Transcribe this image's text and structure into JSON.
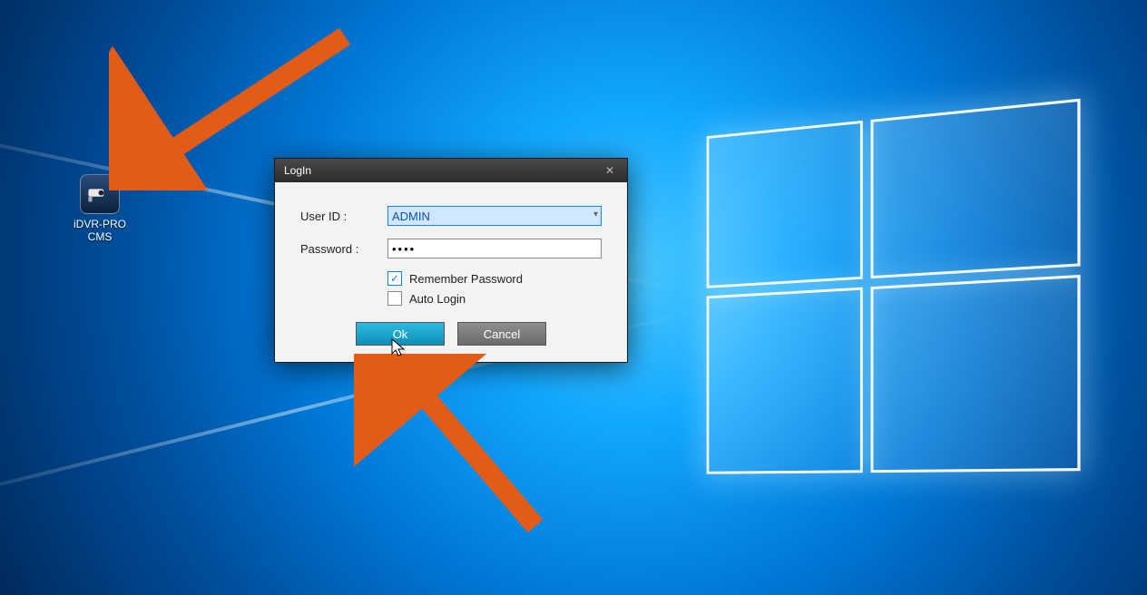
{
  "desktop": {
    "icon_label_line1": "iDVR-PRO",
    "icon_label_line2": "CMS"
  },
  "dialog": {
    "title": "LogIn",
    "user_id_label": "User ID :",
    "user_id_value": "ADMIN",
    "password_label": "Password :",
    "password_value": "••••",
    "remember_label": "Remember Password",
    "remember_checked": true,
    "auto_login_label": "Auto Login",
    "auto_login_checked": false,
    "ok_label": "Ok",
    "cancel_label": "Cancel"
  },
  "annotations": {
    "arrow_color": "#e35c17"
  }
}
